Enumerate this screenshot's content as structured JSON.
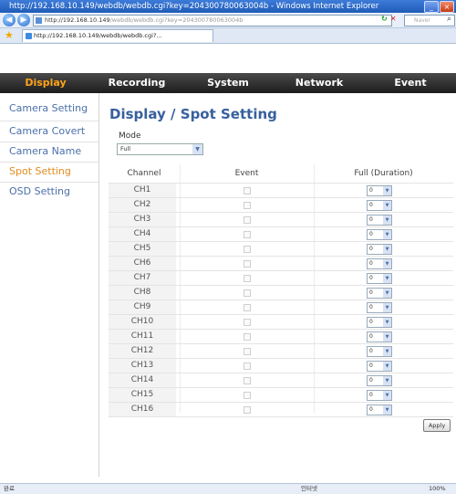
{
  "window": {
    "title": "http://192.168.10.149/webdb/webdb.cgi?key=204300780063004b - Windows Internet Explorer"
  },
  "browser": {
    "address_host": "http://192.168.10.149",
    "address_rest": "/webdb/webdb.cgi?key=204300780063004b",
    "search_placeholder": "Naver",
    "tab_title": "http://192.168.10.149/webdb/webdb.cgi?...",
    "status_left": "완료",
    "status_zone": "인터넷",
    "status_zoom": "100%"
  },
  "menu": {
    "items": [
      "Display",
      "Recording",
      "System",
      "Network",
      "Event"
    ],
    "active_index": 0
  },
  "sidebar": {
    "items": [
      "Camera Setting",
      "Camera Covert",
      "Camera Name",
      "Spot Setting",
      "OSD Setting"
    ],
    "active_index": 3
  },
  "page": {
    "title": "Display / Spot Setting",
    "mode_label": "Mode",
    "mode_value": "Full"
  },
  "grid": {
    "headers": [
      "Channel",
      "Event",
      "Full (Duration)"
    ],
    "rows": [
      {
        "channel": "CH1",
        "event_checked": false,
        "duration": "0"
      },
      {
        "channel": "CH2",
        "event_checked": false,
        "duration": "0"
      },
      {
        "channel": "CH3",
        "event_checked": false,
        "duration": "0"
      },
      {
        "channel": "CH4",
        "event_checked": false,
        "duration": "0"
      },
      {
        "channel": "CH5",
        "event_checked": false,
        "duration": "0"
      },
      {
        "channel": "CH6",
        "event_checked": false,
        "duration": "0"
      },
      {
        "channel": "CH7",
        "event_checked": false,
        "duration": "0"
      },
      {
        "channel": "CH8",
        "event_checked": false,
        "duration": "0"
      },
      {
        "channel": "CH9",
        "event_checked": false,
        "duration": "0"
      },
      {
        "channel": "CH10",
        "event_checked": false,
        "duration": "0"
      },
      {
        "channel": "CH11",
        "event_checked": false,
        "duration": "0"
      },
      {
        "channel": "CH12",
        "event_checked": false,
        "duration": "0"
      },
      {
        "channel": "CH13",
        "event_checked": false,
        "duration": "0"
      },
      {
        "channel": "CH14",
        "event_checked": false,
        "duration": "0"
      },
      {
        "channel": "CH15",
        "event_checked": false,
        "duration": "0"
      },
      {
        "channel": "CH16",
        "event_checked": false,
        "duration": "0"
      }
    ]
  },
  "buttons": {
    "apply": "Apply"
  },
  "colors": {
    "menu_active": "#ffa319",
    "sidebar_active": "#e58a1c",
    "link": "#4a6fa8",
    "title": "#36609e"
  }
}
